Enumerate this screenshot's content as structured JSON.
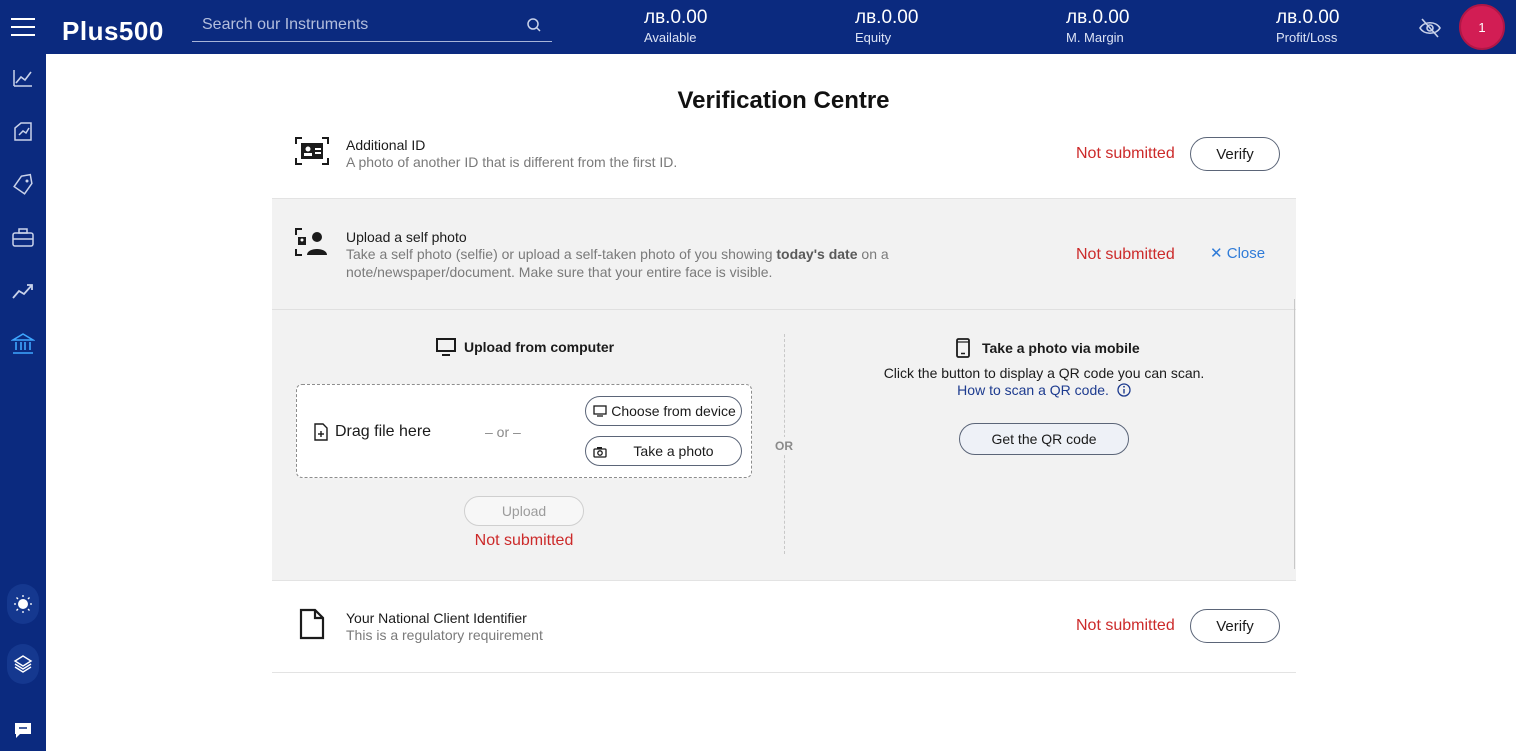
{
  "header": {
    "logo_text": "Plus500",
    "search_placeholder": "Search our Instruments",
    "stats": [
      {
        "value": "лв.0.00",
        "label": "Available"
      },
      {
        "value": "лв.0.00",
        "label": "Equity"
      },
      {
        "value": "лв.0.00",
        "label": "M. Margin"
      },
      {
        "value": "лв.0.00",
        "label": "Profit/Loss"
      }
    ],
    "notification_count": "1"
  },
  "page": {
    "title": "Verification Centre"
  },
  "items": [
    {
      "title": "Additional ID",
      "description": "A photo of another ID that is different from the first ID.",
      "status": "Not submitted",
      "button": "Verify"
    },
    {
      "title": "Upload a self photo",
      "description_pre": "Take a self photo (selfie) or upload a self-taken photo of you showing ",
      "description_bold": "today's date",
      "description_post": " on a note/newspaper/document. Make sure that your entire face is visible.",
      "status": "Not submitted",
      "close_label": "Close"
    },
    {
      "title": "Your National Client Identifier",
      "description": "This is a regulatory requirement",
      "status": "Not submitted",
      "button": "Verify"
    }
  ],
  "upload_panel": {
    "computer_heading": "Upload from computer",
    "drag_label": "Drag file here",
    "or_dash": "– or –",
    "choose_button": "Choose from device",
    "photo_button": "Take a photo",
    "upload_button": "Upload",
    "upload_status": "Not submitted",
    "or_label": "OR",
    "mobile_heading": "Take a photo via mobile",
    "mobile_text": "Click the button to display a QR code you can scan.",
    "qr_help_link": "How to scan a QR code.",
    "qr_button": "Get the QR code"
  },
  "colors": {
    "brand_navy": "#0b2a7f",
    "status_red": "#cc2a2a",
    "link_blue": "#2f7bd8",
    "avatar_pink": "#d21d54"
  }
}
